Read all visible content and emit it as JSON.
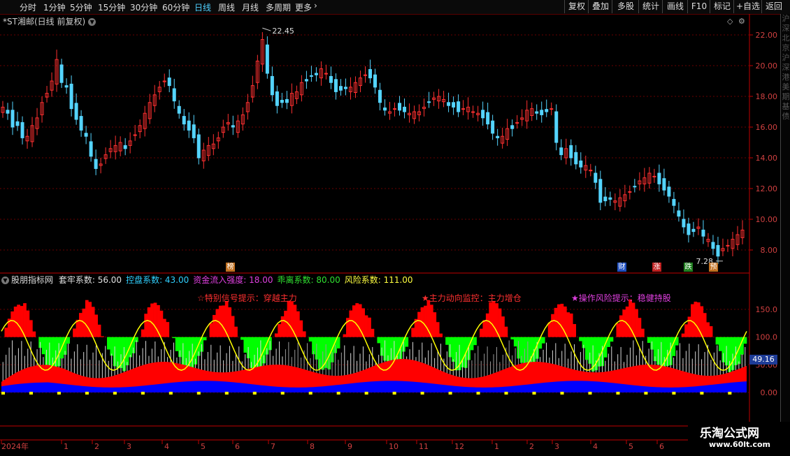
{
  "toolbar": {
    "periods": [
      "分时",
      "1分钟",
      "5分钟",
      "15分钟",
      "30分钟",
      "60分钟",
      "日线",
      "周线",
      "月线",
      "多周期",
      "更多"
    ],
    "active_period": "日线",
    "more_arrow": "›",
    "right_buttons": [
      "复权",
      "叠加",
      "多股",
      "统计",
      "画线",
      "F10",
      "标记",
      "+自选",
      "返回"
    ]
  },
  "main_chart": {
    "title": "*ST湘邮(日线 前复权)",
    "high_label": "22.45",
    "low_label": "7.28",
    "y_ticks": [
      "22.00",
      "20.00",
      "18.00",
      "16.00",
      "14.00",
      "12.00",
      "10.00",
      "8.00"
    ],
    "badges": [
      {
        "text": "榜",
        "color": "#c07020"
      },
      {
        "text": "财",
        "color": "#2050c0"
      },
      {
        "text": "涨",
        "color": "#c02020"
      },
      {
        "text": "跌",
        "color": "#208020"
      },
      {
        "text": "预",
        "color": "#c07020"
      }
    ]
  },
  "indicator": {
    "name": "股朋指标网",
    "params": [
      {
        "label": "套牢系数: 56.00",
        "color": "#e0e0e0"
      },
      {
        "label": "控盘系数: 43.00",
        "color": "#30d0ff"
      },
      {
        "label": "资金流入强度: 18.00",
        "color": "#e040e0"
      },
      {
        "label": "乖离系数: 80.00",
        "color": "#30e030"
      },
      {
        "label": "风险系数: 111.00",
        "color": "#ffff40"
      }
    ],
    "signals": [
      {
        "text": "☆特别信号提示：穿越主力",
        "color": "#ff3030"
      },
      {
        "text": "★主力动向监控：主力增仓",
        "color": "#ff3030"
      },
      {
        "text": "★操作风险提示：稳健持股",
        "color": "#e040e0"
      }
    ],
    "y_ticks": [
      "150.0",
      "100.0",
      "50.00",
      "0.00"
    ],
    "current_value": "49.16"
  },
  "x_axis": {
    "labels": [
      "2024年",
      "1",
      "2",
      "3",
      "4",
      "5",
      "6",
      "7",
      "8",
      "9",
      "10",
      "11",
      "12",
      "1",
      "2",
      "3",
      "4",
      "5",
      "6"
    ]
  },
  "right_panel_text": [
    "沪",
    "深",
    "北",
    "京",
    "沪",
    "深",
    "港",
    "美",
    "期",
    "基",
    "债"
  ],
  "watermark": {
    "title": "乐淘公式网",
    "url": "www.60lt.com"
  },
  "colors": {
    "up": "#ff3030",
    "down": "#54d4ff",
    "grid": "#6a0000",
    "axis": "#c00000",
    "red_bar": "#ff0000",
    "green_bar": "#00ff00",
    "blue_area": "#0000ff",
    "yellow_line": "#ffff00",
    "white_bar": "#d8d8d8",
    "grey_bar": "#999999"
  },
  "price_series": [
    17.3,
    16.9,
    16.0,
    16.1,
    15.3,
    15.4,
    16.1,
    16.6,
    17.6,
    18.2,
    19.0,
    20.4,
    18.9,
    18.6,
    17.2,
    16.5,
    15.8,
    15.4,
    14.1,
    13.3,
    13.6,
    14.2,
    14.6,
    14.8,
    15.0,
    14.6,
    15.1,
    15.5,
    16.1,
    16.9,
    17.6,
    18.1,
    18.6,
    19.0,
    18.7,
    17.7,
    16.9,
    16.2,
    15.8,
    15.3,
    14.0,
    14.5,
    14.8,
    14.9,
    15.3,
    16.0,
    16.3,
    16.0,
    16.4,
    16.8,
    17.6,
    18.7,
    20.3,
    21.7,
    19.5,
    18.1,
    17.4,
    17.6,
    17.6,
    18.2,
    18.3,
    18.9,
    19.0,
    19.3,
    19.4,
    19.8,
    19.5,
    18.9,
    18.3,
    18.4,
    18.5,
    18.6,
    18.9,
    19.2,
    19.4,
    19.2,
    18.6,
    17.6,
    17.1,
    17.0,
    17.2,
    17.1,
    17.0,
    16.9,
    17.0,
    17.0,
    17.3,
    17.6,
    17.9,
    18.0,
    17.8,
    17.4,
    17.3,
    17.0,
    17.2,
    17.3,
    17.0,
    16.9,
    16.6,
    16.2,
    15.6,
    15.3,
    15.4,
    15.9,
    15.9,
    16.3,
    16.6,
    17.1,
    17.2,
    16.9,
    16.8,
    17.0,
    17.2,
    15.0,
    14.2,
    14.6,
    14.0,
    13.6,
    13.4,
    13.5,
    13.2,
    12.4,
    11.1,
    11.2,
    11.3,
    11.2,
    11.4,
    11.6,
    11.8,
    12.1,
    12.5,
    12.7,
    13.0,
    12.8,
    12.3,
    11.9,
    11.5,
    10.9,
    10.2,
    9.5,
    9.0,
    9.2,
    9.5,
    8.9,
    8.7,
    8.1,
    7.6,
    8.1,
    8.3,
    8.7,
    9.0,
    9.3
  ]
}
